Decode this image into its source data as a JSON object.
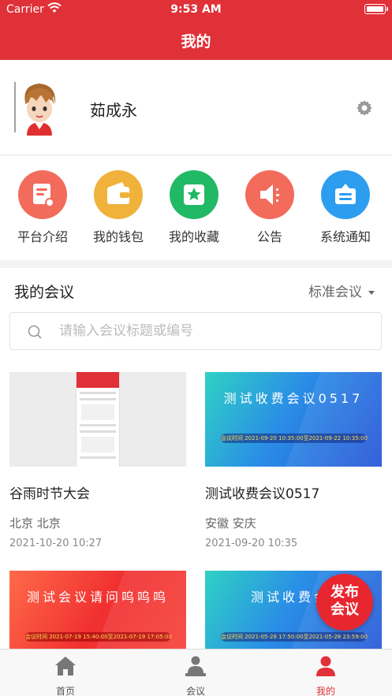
{
  "status": {
    "carrier": "Carrier",
    "time": "9:53 AM"
  },
  "nav": {
    "title": "我的"
  },
  "profile": {
    "name": "茹成永"
  },
  "shortcuts": [
    {
      "label": "平台介绍",
      "icon": "document-icon",
      "color": "#f26b5b"
    },
    {
      "label": "我的钱包",
      "icon": "wallet-icon",
      "color": "#f0b23a"
    },
    {
      "label": "我的收藏",
      "icon": "star-icon",
      "color": "#22b966"
    },
    {
      "label": "公告",
      "icon": "megaphone-icon",
      "color": "#f26b5b"
    },
    {
      "label": "系统通知",
      "icon": "notification-icon",
      "color": "#2d9df0"
    }
  ],
  "meetings": {
    "title": "我的会议",
    "filter": "标准会议",
    "search_placeholder": "请输入会议标题或编号",
    "cards": [
      {
        "title": "谷雨时节大会",
        "location": "北京  北京",
        "date": "2021-10-20 10:27",
        "banner_text": "",
        "banner_time": ""
      },
      {
        "title": "测试收费会议0517",
        "location": "安徽  安庆",
        "date": "2021-09-20 10:35",
        "banner_text": "测试收费会议0517",
        "banner_time": "会议时间 2021-09-20 10:35:00至2021-09-22 10:35:00"
      },
      {
        "title": "",
        "location": "",
        "date": "",
        "banner_text": "测试会议请问呜呜呜",
        "banner_time": "会议时间 2021-07-19 15:40:00至2021-07-19 17:05:00"
      },
      {
        "title": "",
        "location": "",
        "date": "",
        "banner_text": "测试收费会",
        "banner_time": "会议时间 2021-05-28 17:50:00至2021-05-28 23:59:00"
      }
    ]
  },
  "publish": {
    "line1": "发布",
    "line2": "会议"
  },
  "tabs": [
    {
      "label": "首页",
      "icon": "home-icon"
    },
    {
      "label": "会议",
      "icon": "meeting-icon"
    },
    {
      "label": "我的",
      "icon": "profile-icon"
    }
  ],
  "colors": {
    "brand": "#e03138"
  }
}
